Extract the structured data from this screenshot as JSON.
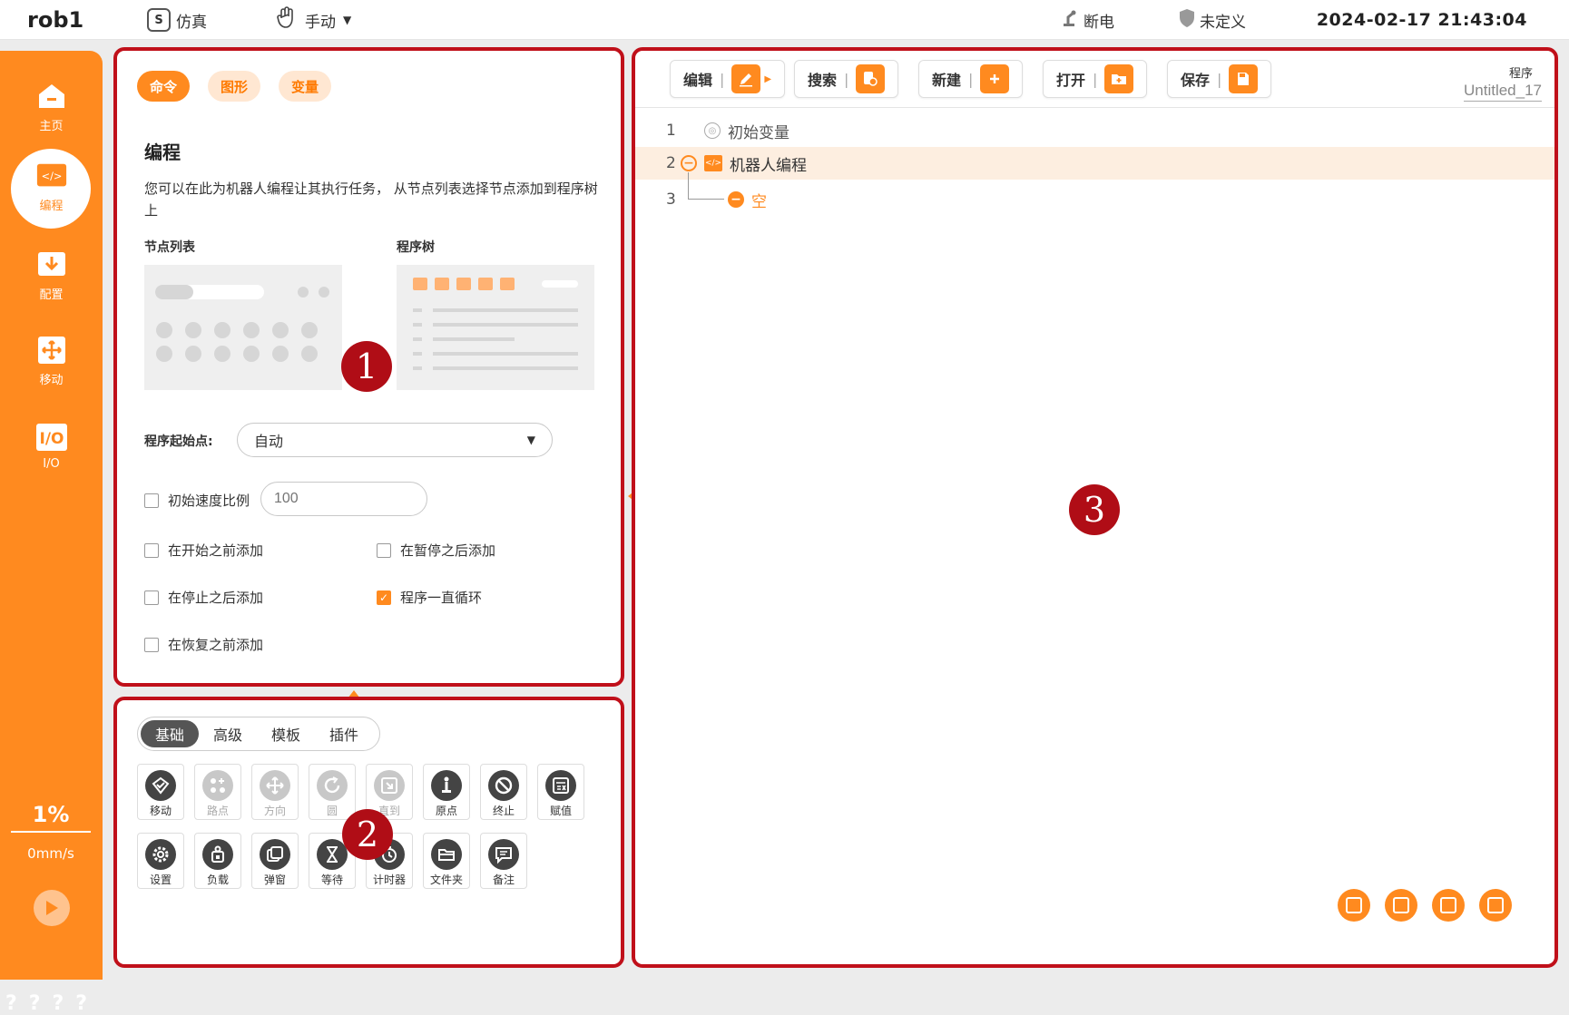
{
  "topbar": {
    "robot": "rob1",
    "sim_icon": "S",
    "sim_label": "仿真",
    "mode_label": "手动",
    "power_label": "断电",
    "safety_label": "未定义",
    "datetime": "2024-02-17 21:43:04"
  },
  "sidebar": {
    "items": [
      {
        "label": "主页",
        "icon": "home-icon"
      },
      {
        "label": "编程",
        "icon": "code-icon"
      },
      {
        "label": "配置",
        "icon": "download-icon"
      },
      {
        "label": "移动",
        "icon": "move-icon"
      },
      {
        "label": "I/O",
        "icon": "io-icon"
      }
    ],
    "io_glyph": "I/O",
    "speed_percent": "1%",
    "speed_mm": "0mm/s",
    "help": [
      "?",
      "?",
      "?",
      "?"
    ]
  },
  "panel1": {
    "tabs": [
      "命令",
      "图形",
      "变量"
    ],
    "title": "编程",
    "description": "您可以在此为机器人编程让其执行任务， 从节点列表选择节点添加到程序树上",
    "node_list_label": "节点列表",
    "program_tree_label": "程序树",
    "start_label": "程序起始点:",
    "start_value": "自动",
    "init_speed_label": "初始速度比例",
    "init_speed_placeholder": "100",
    "options": [
      {
        "label": "在开始之前添加",
        "checked": false
      },
      {
        "label": "在暂停之后添加",
        "checked": false
      },
      {
        "label": "在停止之后添加",
        "checked": false
      },
      {
        "label": "程序一直循环",
        "checked": true
      },
      {
        "label": "在恢复之前添加",
        "checked": false
      }
    ],
    "badge": "1"
  },
  "panel2": {
    "tabs": [
      "基础",
      "高级",
      "模板",
      "插件"
    ],
    "tools": [
      {
        "label": "移动",
        "icon": "move-check-icon",
        "enabled": true
      },
      {
        "label": "路点",
        "icon": "waypoint-icon",
        "enabled": false
      },
      {
        "label": "方向",
        "icon": "direction-icon",
        "enabled": false
      },
      {
        "label": "圆",
        "icon": "circle-icon",
        "enabled": false
      },
      {
        "label": "直到",
        "icon": "until-icon",
        "enabled": false
      },
      {
        "label": "原点",
        "icon": "origin-icon",
        "enabled": true
      },
      {
        "label": "终止",
        "icon": "stop-icon",
        "enabled": true
      },
      {
        "label": "赋值",
        "icon": "assign-icon",
        "enabled": true
      },
      {
        "label": "设置",
        "icon": "gear-icon",
        "enabled": true
      },
      {
        "label": "负载",
        "icon": "payload-icon",
        "enabled": true
      },
      {
        "label": "弹窗",
        "icon": "popup-icon",
        "enabled": true
      },
      {
        "label": "等待",
        "icon": "hourglass-icon",
        "enabled": true
      },
      {
        "label": "计时器",
        "icon": "timer-icon",
        "enabled": true
      },
      {
        "label": "文件夹",
        "icon": "folder-icon",
        "enabled": true
      },
      {
        "label": "备注",
        "icon": "comment-icon",
        "enabled": true
      }
    ],
    "badge": "2"
  },
  "panel3": {
    "toolbar": [
      "编辑",
      "搜索",
      "新建",
      "打开",
      "保存"
    ],
    "program_label": "程序",
    "program_name": "Untitled_17",
    "tree": [
      {
        "num": "1",
        "label": "初始变量"
      },
      {
        "num": "2",
        "label": "机器人编程"
      },
      {
        "num": "3",
        "label": "空"
      }
    ],
    "badge": "3"
  },
  "colors": {
    "accent": "#ff8a1f",
    "annotation": "#c0101a"
  }
}
